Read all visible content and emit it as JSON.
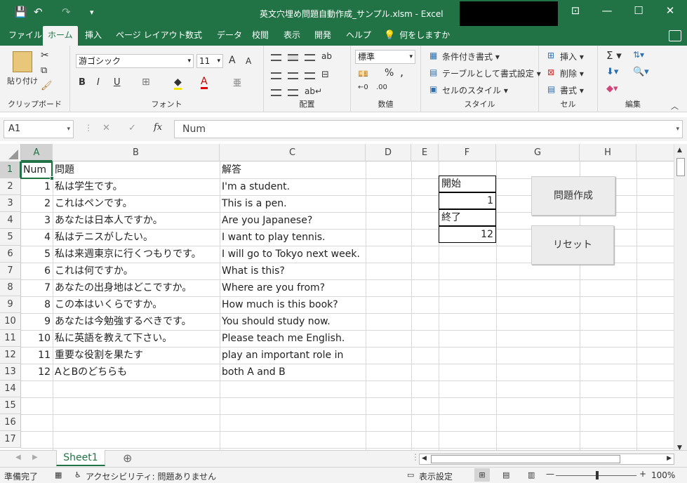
{
  "titlebar": {
    "title": "英文穴埋め問題自動作成_サンプル.xlsm  -  Excel",
    "save_icon": "💾",
    "undo_icon": "↶",
    "redo_icon": "↷",
    "customize_icon": "▾",
    "restore_ribbon_icon": "⊡",
    "minimize_icon": "—",
    "maximize_icon": "☐",
    "close_icon": "✕"
  },
  "tabs": [
    "ファイル",
    "ホーム",
    "挿入",
    "ページ レイアウト",
    "数式",
    "データ",
    "校閲",
    "表示",
    "開発",
    "ヘルプ"
  ],
  "tell_me": "何をしますか",
  "ribbon": {
    "clipboard": {
      "paste": "貼り付け",
      "label": "クリップボード"
    },
    "font": {
      "name": "游ゴシック",
      "size": "11",
      "label": "フォント",
      "grow": "A",
      "shrink": "A",
      "bold": "B",
      "italic": "I",
      "underline": "U"
    },
    "alignment": {
      "label": "配置"
    },
    "number": {
      "format": "標準",
      "label": "数値",
      "percent": "%",
      "comma": ","
    },
    "styles": {
      "conditional": "条件付き書式",
      "table": "テーブルとして書式設定",
      "cell_styles": "セルのスタイル",
      "label": "スタイル"
    },
    "cells": {
      "insert": "挿入",
      "delete": "削除",
      "format": "書式",
      "label": "セル"
    },
    "editing": {
      "label": "編集"
    }
  },
  "formula_bar": {
    "name_box": "A1",
    "cancel": "✕",
    "enter": "✓",
    "fx": "fx",
    "content": "Num"
  },
  "columns": [
    "A",
    "B",
    "C",
    "D",
    "E",
    "F",
    "G",
    "H"
  ],
  "rows": [
    "1",
    "2",
    "3",
    "4",
    "5",
    "6",
    "7",
    "8",
    "9",
    "10",
    "11",
    "12",
    "13",
    "14",
    "15",
    "16",
    "17"
  ],
  "header_row": {
    "a": "Num",
    "b": "問題",
    "c": "解答"
  },
  "data_rows": [
    {
      "num": "1",
      "q": "私は学生です。",
      "a": "I'm a student."
    },
    {
      "num": "2",
      "q": "これはペンです。",
      "a": "This is a pen."
    },
    {
      "num": "3",
      "q": "あなたは日本人ですか。",
      "a": "Are you Japanese?"
    },
    {
      "num": "4",
      "q": "私はテニスがしたい。",
      "a": "I want to play tennis."
    },
    {
      "num": "5",
      "q": "私は来週東京に行くつもりです。",
      "a": "I will go to Tokyo next week."
    },
    {
      "num": "6",
      "q": "これは何ですか。",
      "a": "What is this?"
    },
    {
      "num": "7",
      "q": "あなたの出身地はどこですか。",
      "a": "Where are you from?"
    },
    {
      "num": "8",
      "q": "この本はいくらですか。",
      "a": "How much is this book?"
    },
    {
      "num": "9",
      "q": "あなたは今勉強するべきです。",
      "a": "You should study now."
    },
    {
      "num": "10",
      "q": "私に英語を教えて下さい。",
      "a": "Please teach me English."
    },
    {
      "num": "11",
      "q": "重要な役割を果たす",
      "a": "play an important role in"
    },
    {
      "num": "12",
      "q": "AとBのどちらも",
      "a": "both A and B"
    }
  ],
  "f_column": {
    "start_label": "開始",
    "start_value": "1",
    "end_label": "終了",
    "end_value": "12"
  },
  "buttons": {
    "create": "問題作成",
    "reset": "リセット"
  },
  "sheet": {
    "name": "Sheet1",
    "add": "⊕"
  },
  "status": {
    "ready": "準備完了",
    "accessibility": "アクセシビリティ: 問題ありません",
    "display_settings": "表示設定",
    "zoom": "100%",
    "minus": "—",
    "plus": "+"
  }
}
